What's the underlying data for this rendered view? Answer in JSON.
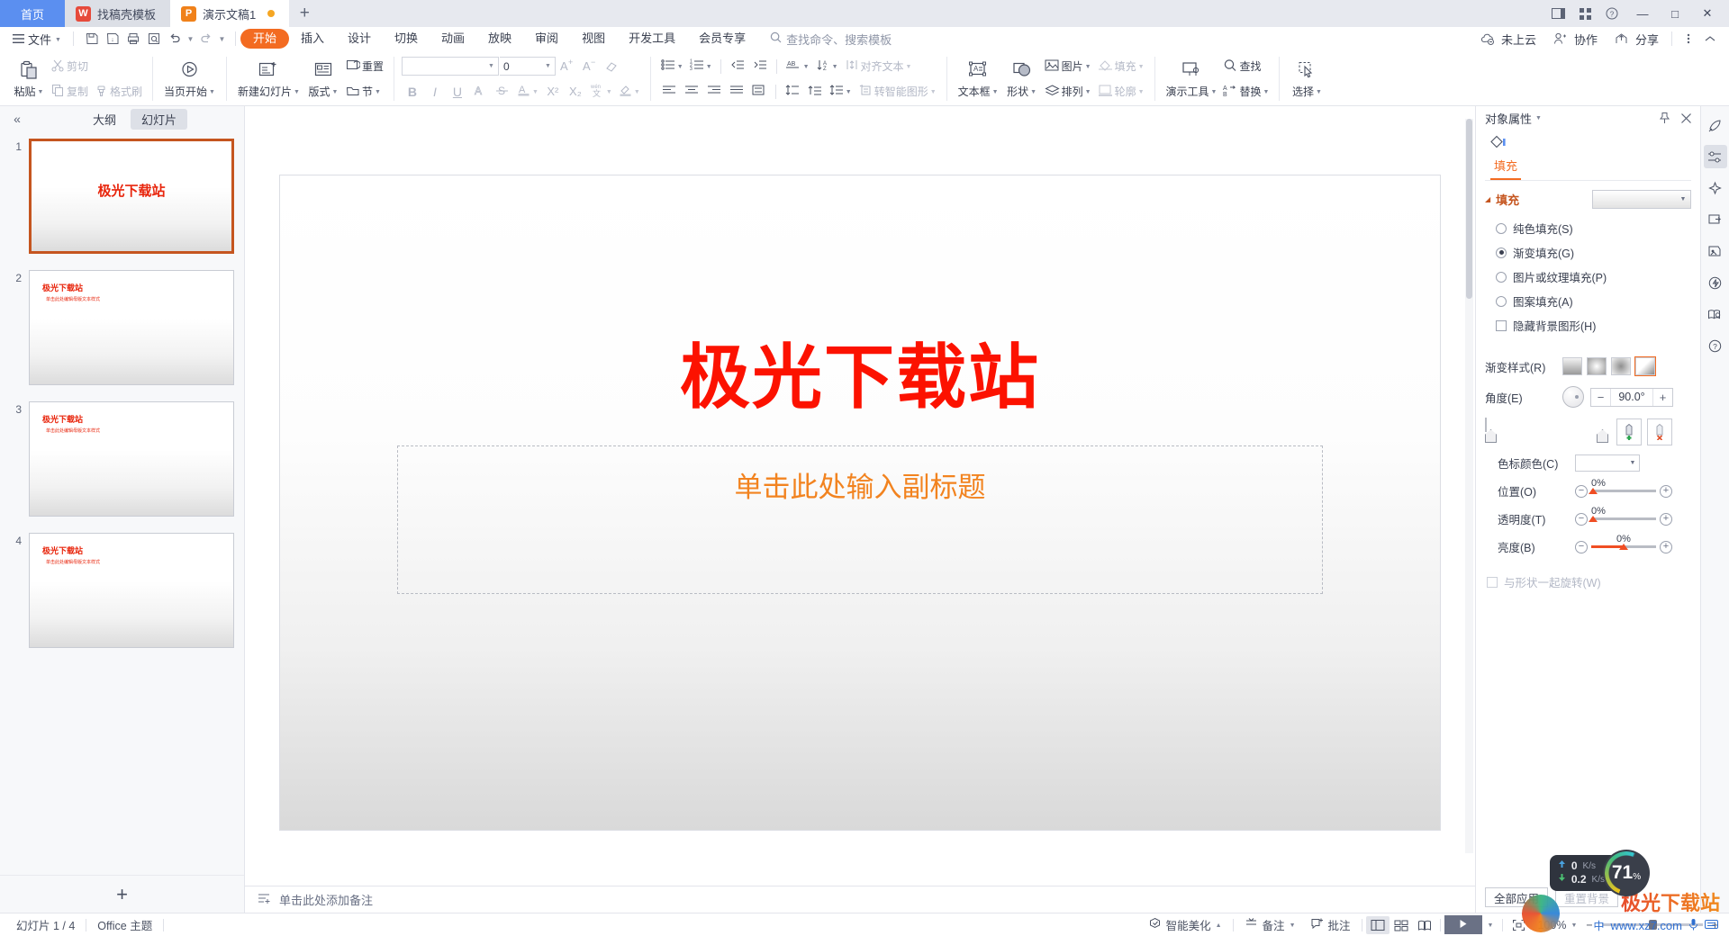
{
  "window": {
    "tabs": [
      {
        "label": "首页",
        "type": "home"
      },
      {
        "label": "找稿壳模板",
        "type": "doc",
        "icon": "wps-red-icon",
        "state": "inactive"
      },
      {
        "label": "演示文稿1",
        "type": "doc",
        "icon": "wpp-orange-icon",
        "state": "active",
        "modified": true
      }
    ],
    "new_tab_label": "+",
    "right_icons": [
      "sidebar-toggle-icon",
      "grid-view-icon",
      "help-question-icon"
    ],
    "controls": {
      "minimize": "—",
      "maximize": "□",
      "close": "✕"
    }
  },
  "menubar": {
    "file_label": "文件",
    "quick_access": [
      "save-icon",
      "save-as-icon",
      "print-icon",
      "print-preview-icon",
      "undo-icon",
      "redo-icon"
    ],
    "ribbon_tabs": [
      {
        "label": "开始",
        "active": true
      },
      {
        "label": "插入",
        "active": false
      },
      {
        "label": "设计",
        "active": false
      },
      {
        "label": "切换",
        "active": false
      },
      {
        "label": "动画",
        "active": false
      },
      {
        "label": "放映",
        "active": false
      },
      {
        "label": "审阅",
        "active": false
      },
      {
        "label": "视图",
        "active": false
      },
      {
        "label": "开发工具",
        "active": false
      },
      {
        "label": "会员专享",
        "active": false
      }
    ],
    "search_placeholder": "查找命令、搜索模板",
    "right_items": [
      {
        "label": "未上云",
        "icon": "cloud-off-icon"
      },
      {
        "label": "协作",
        "icon": "collaborate-icon"
      },
      {
        "label": "分享",
        "icon": "share-icon"
      }
    ],
    "more_icon": "more-vertical-icon",
    "collapse_icon": "chevron-up-icon"
  },
  "ribbon": {
    "groups": [
      {
        "name": "clipboard",
        "big": [
          {
            "label": "粘贴",
            "icon": "paste-icon",
            "dropdown": true,
            "disabled": false
          }
        ],
        "small": [
          {
            "label": "剪切",
            "icon": "scissors-icon",
            "disabled": true
          },
          {
            "label": "复制",
            "icon": "copy-icon",
            "disabled": true
          },
          {
            "label": "格式刷",
            "icon": "format-painter-icon",
            "disabled": true
          }
        ]
      },
      {
        "name": "present",
        "big": [
          {
            "label": "当页开始",
            "icon": "play-circle-icon",
            "dropdown": true,
            "disabled": false
          }
        ]
      },
      {
        "name": "slides",
        "big": [
          {
            "label": "新建幻灯片",
            "icon": "new-slide-icon",
            "dropdown": true
          },
          {
            "label": "版式",
            "icon": "layout-icon",
            "dropdown": true
          }
        ],
        "small": [
          {
            "label": "重置",
            "icon": "reset-icon"
          },
          {
            "label": "节",
            "icon": "section-icon",
            "dropdown": true
          }
        ]
      },
      {
        "name": "font",
        "font_name": "",
        "font_size": "0",
        "row1": [
          {
            "label": "",
            "icon": "increase-font-icon",
            "disabled": true
          },
          {
            "label": "",
            "icon": "decrease-font-icon",
            "disabled": true
          },
          {
            "label": "",
            "icon": "clear-format-icon",
            "disabled": true
          }
        ],
        "row2": [
          {
            "label": "B",
            "icon": "bold-icon",
            "disabled": true
          },
          {
            "label": "I",
            "icon": "italic-icon",
            "disabled": true
          },
          {
            "label": "U",
            "icon": "underline-icon",
            "disabled": true
          },
          {
            "label": "A",
            "icon": "text-effect-icon",
            "disabled": true
          },
          {
            "label": "S",
            "icon": "strikethrough-icon",
            "disabled": true
          },
          {
            "label": "A",
            "icon": "font-color-icon",
            "disabled": true,
            "dropdown": true
          },
          {
            "label": "X²",
            "icon": "superscript-icon",
            "disabled": true
          },
          {
            "label": "X₂",
            "icon": "subscript-icon",
            "disabled": true
          },
          {
            "label": "",
            "icon": "pinyin-guide-icon",
            "disabled": true,
            "dropdown": true
          },
          {
            "label": "",
            "icon": "text-highlight-icon",
            "disabled": true,
            "dropdown": true
          }
        ]
      },
      {
        "name": "paragraph",
        "row1": [
          {
            "icon": "bullet-list-icon",
            "dropdown": true
          },
          {
            "icon": "numbered-list-icon",
            "dropdown": true
          },
          {
            "icon": "decrease-indent-icon"
          },
          {
            "icon": "increase-indent-icon"
          },
          {
            "icon": "text-direction-icon",
            "dropdown": true
          },
          {
            "icon": "sort-icon",
            "dropdown": true
          },
          {
            "label": "对齐文本",
            "icon": "align-text-icon",
            "dropdown": true,
            "disabled": true
          }
        ],
        "row2": [
          {
            "icon": "align-left-icon"
          },
          {
            "icon": "align-center-icon"
          },
          {
            "icon": "align-right-icon"
          },
          {
            "icon": "align-justify-icon"
          },
          {
            "icon": "distribute-icon"
          },
          {
            "icon": "line-spacing-icon"
          },
          {
            "icon": "paragraph-spacing-icon"
          },
          {
            "icon": "spacing-options-icon",
            "dropdown": true
          },
          {
            "label": "转智能图形",
            "icon": "smartart-icon",
            "dropdown": true,
            "disabled": true
          }
        ]
      },
      {
        "name": "drawing",
        "big": [
          {
            "label": "文本框",
            "icon": "textbox-icon",
            "dropdown": true
          },
          {
            "label": "形状",
            "icon": "shapes-icon",
            "dropdown": true
          }
        ],
        "small": [
          {
            "label": "图片",
            "icon": "picture-icon",
            "dropdown": true
          },
          {
            "label": "排列",
            "icon": "arrange-icon",
            "dropdown": true
          },
          {
            "label": "填充",
            "icon": "fill-icon",
            "dropdown": true,
            "disabled": true
          },
          {
            "label": "轮廓",
            "icon": "outline-icon",
            "dropdown": true,
            "disabled": true
          }
        ]
      },
      {
        "name": "tools",
        "big": [
          {
            "label": "演示工具",
            "icon": "presentation-tool-icon",
            "dropdown": true
          }
        ],
        "small": [
          {
            "label": "查找",
            "icon": "search-icon"
          },
          {
            "label": "替换",
            "icon": "replace-icon",
            "dropdown": true
          }
        ]
      },
      {
        "name": "select",
        "big": [
          {
            "label": "选择",
            "icon": "select-icon",
            "dropdown": true
          }
        ]
      }
    ]
  },
  "slide_panel": {
    "collapse_icon": "double-chevron-left-icon",
    "tabs": [
      {
        "label": "大纲",
        "active": false
      },
      {
        "label": "幻灯片",
        "active": true
      }
    ],
    "slides": [
      {
        "num": "1",
        "selected": true,
        "layout": "title",
        "title": "极光下载站"
      },
      {
        "num": "2",
        "selected": false,
        "layout": "content",
        "title": "极光下载站",
        "bullet": "单击此处编辑母版文本样式"
      },
      {
        "num": "3",
        "selected": false,
        "layout": "content",
        "title": "极光下载站",
        "bullet": "单击此处编辑母版文本样式"
      },
      {
        "num": "4",
        "selected": false,
        "layout": "content",
        "title": "极光下载站",
        "bullet": "单击此处编辑母版文本样式"
      }
    ],
    "add_slide_label": "+"
  },
  "canvas": {
    "slide_title": "极光下载站",
    "slide_subtitle": "单击此处输入副标题",
    "title_color": "#fc1200",
    "subtitle_color": "#f2831f",
    "notes_placeholder": "单击此处添加备注",
    "notes_icon": "notes-icon"
  },
  "right_panel": {
    "header_title": "对象属性",
    "pin_icon": "pin-icon",
    "close_icon": "close-icon",
    "tab_icon": "fill-bucket-icon",
    "tab_label": "填充",
    "section_title": "填充",
    "fill_options": [
      {
        "label": "纯色填充(S)",
        "selected": false,
        "key": "S"
      },
      {
        "label": "渐变填充(G)",
        "selected": true,
        "key": "G"
      },
      {
        "label": "图片或纹理填充(P)",
        "selected": false,
        "key": "P"
      },
      {
        "label": "图案填充(A)",
        "selected": false,
        "key": "A"
      }
    ],
    "hide_bg_label": "隐藏背景图形(H)",
    "hide_bg_checked": false,
    "gradient_style_label": "渐变样式(R)",
    "gradient_styles": [
      "linear-swatch",
      "radial-swatch",
      "rectangular-swatch",
      "path-swatch"
    ],
    "gradient_style_selected": 3,
    "angle_label": "角度(E)",
    "angle_value": "90.0°",
    "angle_minus": "−",
    "angle_plus": "+",
    "add_stop_icon": "add-gradient-stop-icon",
    "remove_stop_icon": "remove-gradient-stop-icon",
    "stop_color_label": "色标颜色(C)",
    "position_label": "位置(O)",
    "position_value": "0%",
    "transparency_label": "透明度(T)",
    "transparency_value": "0%",
    "brightness_label": "亮度(B)",
    "brightness_value": "0%",
    "rotate_with_shape_label": "与形状一起旋转(W)",
    "rotate_with_shape_checked": false,
    "apply_all_label": "全部应用",
    "reset_bg_label": "重置背景"
  },
  "rail_icons": [
    {
      "name": "rocket-icon",
      "active": false
    },
    {
      "name": "sliders-icon",
      "active": true
    },
    {
      "name": "magic-star-icon",
      "active": false
    },
    {
      "name": "screen-share-icon",
      "active": false
    },
    {
      "name": "picture-tool-icon",
      "active": false
    },
    {
      "name": "lightning-badge-icon",
      "active": false
    },
    {
      "name": "book-search-icon",
      "active": false
    },
    {
      "name": "help-circle-icon",
      "active": false
    }
  ],
  "statusbar": {
    "slide_counter": "幻灯片 1 / 4",
    "theme": "Office 主题",
    "beautify_label": "智能美化",
    "beautify_icon": "beautify-icon",
    "notes_label": "备注",
    "notes_icon": "notes-toggle-icon",
    "comment_label": "批注",
    "comment_icon": "comment-icon",
    "views": [
      {
        "icon": "normal-view-icon",
        "active": true
      },
      {
        "icon": "slide-sorter-icon",
        "active": false
      },
      {
        "icon": "reading-view-icon",
        "active": false
      }
    ],
    "play_icon": "play-icon",
    "fit_icon": "fit-slide-icon",
    "zoom_level": "100%",
    "zoom_minus": "−",
    "zoom_plus": "+"
  },
  "float_widgets": {
    "net_upload": {
      "value": "0",
      "unit": "K/s",
      "icon": "upload-arrow-icon"
    },
    "net_download": {
      "value": "0.2",
      "unit": "K/s",
      "icon": "download-arrow-icon"
    },
    "cpu_percent": "71",
    "cpu_percent_symbol": "%"
  },
  "watermark": {
    "title": "极光下载站",
    "url": "www.xz7.com",
    "ime_lang": "中",
    "ime_icons": [
      "microphone-icon",
      "keyboard-icon"
    ]
  }
}
